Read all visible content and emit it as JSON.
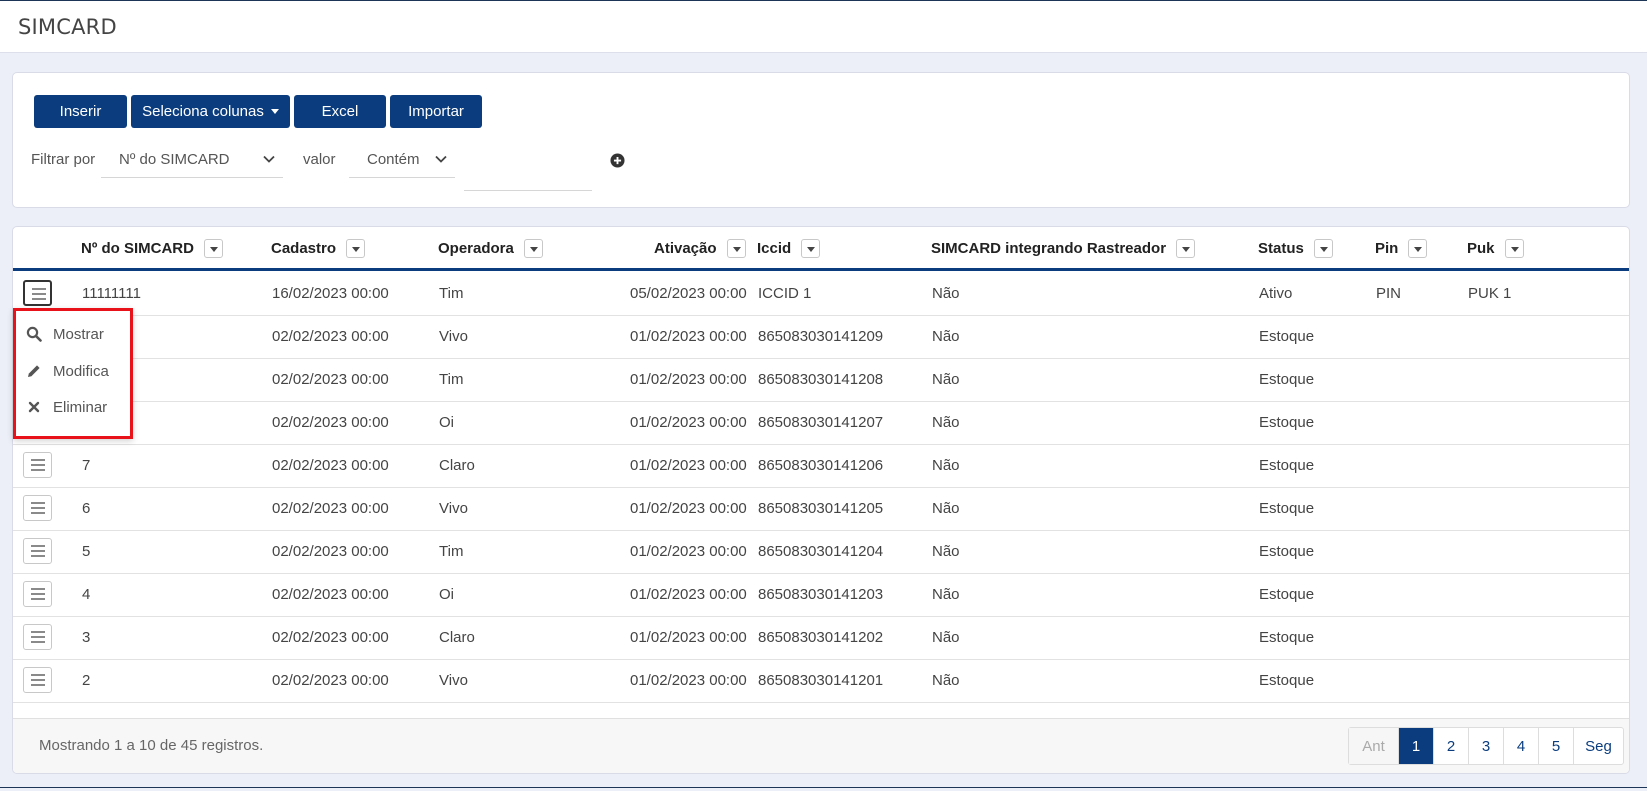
{
  "page": {
    "title": "SIMCARD"
  },
  "toolbar": {
    "insert_label": "Inserir",
    "select_columns_label": "Seleciona colunas",
    "excel_label": "Excel",
    "import_label": "Importar"
  },
  "filter": {
    "filter_by_label": "Filtrar por",
    "field_value": "Nº do SIMCARD",
    "value_label": "valor",
    "operator_value": "Contém",
    "input_value": ""
  },
  "table": {
    "columns": [
      "Nº do SIMCARD",
      "Cadastro",
      "Operadora",
      "Ativação",
      "Iccid",
      "SIMCARD integrando Rastreador",
      "Status",
      "Pin",
      "Puk"
    ],
    "rows": [
      {
        "num": "11111111",
        "cadastro": "16/02/2023 00:00",
        "operadora": "Tim",
        "ativacao": "05/02/2023 00:00",
        "iccid": "ICCID 1",
        "integrando": "Não",
        "status": "Ativo",
        "pin": "PIN",
        "puk": "PUK 1"
      },
      {
        "num": "",
        "cadastro": "02/02/2023 00:00",
        "operadora": "Vivo",
        "ativacao": "01/02/2023 00:00",
        "iccid": "865083030141209",
        "integrando": "Não",
        "status": "Estoque",
        "pin": "",
        "puk": ""
      },
      {
        "num": "",
        "cadastro": "02/02/2023 00:00",
        "operadora": "Tim",
        "ativacao": "01/02/2023 00:00",
        "iccid": "865083030141208",
        "integrando": "Não",
        "status": "Estoque",
        "pin": "",
        "puk": ""
      },
      {
        "num": "",
        "cadastro": "02/02/2023 00:00",
        "operadora": "Oi",
        "ativacao": "01/02/2023 00:00",
        "iccid": "865083030141207",
        "integrando": "Não",
        "status": "Estoque",
        "pin": "",
        "puk": ""
      },
      {
        "num": "7",
        "cadastro": "02/02/2023 00:00",
        "operadora": "Claro",
        "ativacao": "01/02/2023 00:00",
        "iccid": "865083030141206",
        "integrando": "Não",
        "status": "Estoque",
        "pin": "",
        "puk": ""
      },
      {
        "num": "6",
        "cadastro": "02/02/2023 00:00",
        "operadora": "Vivo",
        "ativacao": "01/02/2023 00:00",
        "iccid": "865083030141205",
        "integrando": "Não",
        "status": "Estoque",
        "pin": "",
        "puk": ""
      },
      {
        "num": "5",
        "cadastro": "02/02/2023 00:00",
        "operadora": "Tim",
        "ativacao": "01/02/2023 00:00",
        "iccid": "865083030141204",
        "integrando": "Não",
        "status": "Estoque",
        "pin": "",
        "puk": ""
      },
      {
        "num": "4",
        "cadastro": "02/02/2023 00:00",
        "operadora": "Oi",
        "ativacao": "01/02/2023 00:00",
        "iccid": "865083030141203",
        "integrando": "Não",
        "status": "Estoque",
        "pin": "",
        "puk": ""
      },
      {
        "num": "3",
        "cadastro": "02/02/2023 00:00",
        "operadora": "Claro",
        "ativacao": "01/02/2023 00:00",
        "iccid": "865083030141202",
        "integrando": "Não",
        "status": "Estoque",
        "pin": "",
        "puk": ""
      },
      {
        "num": "2",
        "cadastro": "02/02/2023 00:00",
        "operadora": "Vivo",
        "ativacao": "01/02/2023 00:00",
        "iccid": "865083030141201",
        "integrando": "Não",
        "status": "Estoque",
        "pin": "",
        "puk": ""
      }
    ]
  },
  "row_menu": {
    "show_label": "Mostrar",
    "edit_label": "Modifica",
    "delete_label": "Eliminar"
  },
  "footer": {
    "summary": "Mostrando 1 a 10 de 45 registros.",
    "prev_label": "Ant",
    "next_label": "Seg",
    "pages": [
      "1",
      "2",
      "3",
      "4",
      "5"
    ],
    "current_page": "1"
  },
  "colors": {
    "primary": "#0b3d7e",
    "highlight_border": "#e8121b"
  },
  "icons": {
    "show": "search-icon",
    "edit": "pencil-icon",
    "delete": "close-icon",
    "row_menu": "hamburger-icon",
    "add_filter": "plus-circle-icon"
  }
}
